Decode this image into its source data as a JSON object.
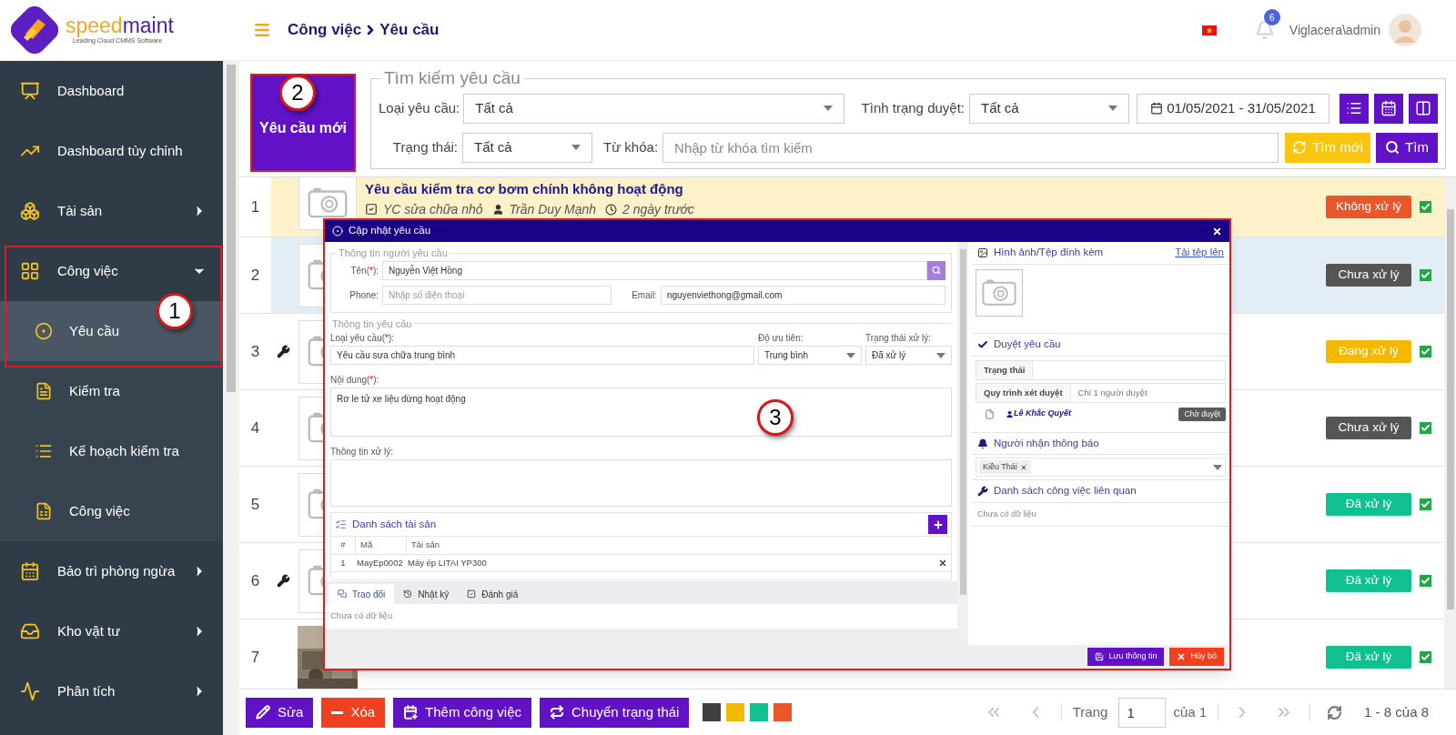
{
  "header": {
    "logo": {
      "brand_first": "speed",
      "brand_second": "maint",
      "tagline": "Leading Cloud CMMS Software"
    },
    "breadcrumb": [
      "Công việc",
      "Yêu cầu"
    ],
    "notifications": "6",
    "user": "Viglacera\\admin"
  },
  "sidebar": {
    "items": [
      {
        "label": "Dashboard"
      },
      {
        "label": "Dashboard tùy chỉnh"
      },
      {
        "label": "Tài sản",
        "expanded": false
      },
      {
        "label": "Công việc",
        "expanded": true,
        "children": [
          {
            "label": "Yêu cầu",
            "selected": true
          },
          {
            "label": "Kiểm tra",
            "selected": false
          },
          {
            "label": "Kế hoạch kiểm tra",
            "selected": false
          },
          {
            "label": "Công việc",
            "selected": false
          }
        ]
      },
      {
        "label": "Bảo trì phòng ngừa",
        "expanded": false
      },
      {
        "label": "Kho vật tư",
        "expanded": false
      },
      {
        "label": "Phân tích",
        "expanded": false
      }
    ]
  },
  "new_request_button": "Yêu cầu mới",
  "search": {
    "legend": "Tìm kiếm yêu cầu",
    "type_label": "Loại yêu cầu:",
    "type_value": "Tất cả",
    "approval_label": "Tình trạng duyệt:",
    "approval_value": "Tất cả",
    "date_range": "01/05/2021 - 31/05/2021",
    "status_label": "Trạng thái:",
    "status_value": "Tất cả",
    "keyword_label": "Từ khóa:",
    "keyword_placeholder": "Nhập từ khóa tìm kiếm",
    "reset_button": "Tìm mới",
    "search_button": "Tìm"
  },
  "requests": [
    {
      "number": "1",
      "highlighted": true,
      "selected": false,
      "has_task": false,
      "thumbnail": {
        "kind": "placeholder"
      },
      "title": "Yêu cầu kiểm tra cơ bơm chính không hoạt động",
      "category": "YC sửa chữa nhỏ",
      "requester": "Trần Duy Mạnh",
      "time": "2 ngày trước",
      "status": {
        "label": "Không xử lý",
        "color": "#e8562a"
      },
      "checked": true
    },
    {
      "number": "2",
      "selected": true,
      "has_task": false,
      "thumbnail": {
        "kind": "placeholder"
      },
      "status": {
        "label": "Chưa xử lý",
        "color": "#555555"
      },
      "checked": true
    },
    {
      "number": "3",
      "highlighted": false,
      "selected": false,
      "has_task": true,
      "thumbnail": {
        "kind": "placeholder"
      },
      "status": {
        "label": "Đang xử lý",
        "color": "#f5b800"
      },
      "checked": true
    },
    {
      "number": "4",
      "highlighted": false,
      "selected": false,
      "has_task": false,
      "thumbnail": {
        "kind": "placeholder"
      },
      "status": {
        "label": "Chưa xử lý",
        "color": "#555555"
      },
      "checked": true
    },
    {
      "number": "5",
      "highlighted": false,
      "selected": false,
      "has_task": false,
      "thumbnail": {
        "kind": "placeholder"
      },
      "status": {
        "label": "Đã xử lý",
        "color": "#10c08f"
      },
      "checked": true
    },
    {
      "number": "6",
      "highlighted": false,
      "selected": false,
      "has_task": true,
      "thumbnail": {
        "kind": "placeholder"
      },
      "status": {
        "label": "Đã xử lý",
        "color": "#10c08f"
      },
      "checked": true
    },
    {
      "number": "7",
      "highlighted": false,
      "selected": false,
      "has_task": false,
      "status": {
        "label": "Đã xử lý",
        "color": "#10c08f"
      },
      "checked": true
    }
  ],
  "modal": {
    "title": "Cập nhật yêu cầu",
    "requester": {
      "legend": "Thông tin người yêu cầu",
      "name": {
        "label_parts": [
          "Tên(",
          "*",
          "):"
        ],
        "value": "Nguyễn  Việt Hồng"
      },
      "phone": {
        "label": "Phone:",
        "placeholder": "Nhập số điện thoại"
      },
      "email": {
        "label": "Email:",
        "value": "nguyenviethong@gmail.com"
      }
    },
    "request": {
      "legend": "Thông tin yêu cầu",
      "type": {
        "label_parts": [
          "Loại yêu cầu(",
          "*",
          "):"
        ],
        "value": "Yêu cầu sưa chữa trung bình"
      },
      "priority": {
        "label": "Độ ưu tiên:",
        "value": "Trung bình"
      },
      "process_status": {
        "label": "Trạng thái xử lý:",
        "value": "Đã xử lý"
      },
      "content": {
        "label_parts": [
          "Nội dung(",
          "*",
          "):"
        ],
        "value": "Rơ le tử xe liệu dừng hoạt động"
      },
      "handling": {
        "label": "Thông tin xử lý:"
      }
    },
    "assets": {
      "title": "Danh sách tài sản",
      "columns": [
        "#",
        "Mã",
        "Tài sản"
      ],
      "rows": [
        [
          "1",
          "MayEp0002",
          "Máy ép LITAI YP300"
        ]
      ]
    },
    "tabs": [
      {
        "label": "Trao đổi",
        "selected": true
      },
      {
        "label": "Nhật ký",
        "selected": false
      },
      {
        "label": "Đánh giá",
        "selected": false
      }
    ],
    "tab_content": "Chưa có dữ liệu",
    "attachments": {
      "title": "Hình ảnh/Tệp đính kèm",
      "upload_link": "Tải tệp lên"
    },
    "approval": {
      "title": "Duyệt yêu cầu",
      "status_tab": "Trạng thái",
      "process_label": "Quy trình xét duyệt",
      "process_value": "Chỉ 1 người duyệt",
      "approver": "Lê Khắc Quyết",
      "approver_status": "Chờ duyệt"
    },
    "notify": {
      "title": "Người nhận thông báo",
      "recipients": [
        "Kiều Thái"
      ]
    },
    "related": {
      "title": "Danh sách công việc liên quan",
      "empty": "Chưa có dữ liệu"
    },
    "buttons": [
      {
        "label": "Lưu thông tin",
        "kind": "save"
      },
      {
        "label": "Hủy bỏ",
        "kind": "cancel"
      }
    ]
  },
  "toolbar": {
    "buttons": [
      {
        "label": "Sửa",
        "kind": "edit"
      },
      {
        "label": "Xóa",
        "kind": "delete"
      },
      {
        "label": "Thêm công việc",
        "kind": "add-task"
      },
      {
        "label": "Chuyển trạng thái",
        "kind": "change-status"
      }
    ],
    "legend_colors": [
      {
        "color": "#3f3f3f"
      },
      {
        "color": "#f5b800"
      },
      {
        "color": "#10c08f"
      },
      {
        "color": "#e8562a"
      }
    ]
  },
  "pagination": {
    "page_label": "Trang",
    "page": "1",
    "of_label": "của 1",
    "range": "1 - 8 của 8"
  },
  "annotations": [
    {
      "label": "1"
    },
    {
      "label": "2"
    },
    {
      "label": "3"
    }
  ]
}
